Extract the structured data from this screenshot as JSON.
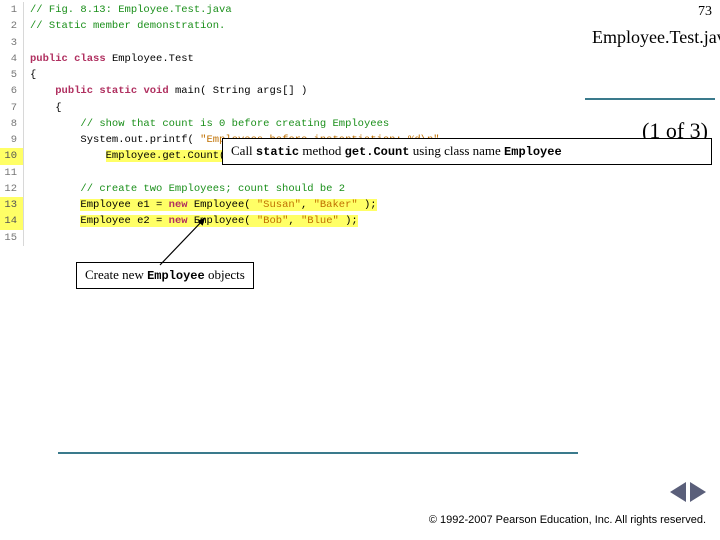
{
  "page_number": "73",
  "title": "Employee.Test.java",
  "part": "(1 of 3)",
  "code": {
    "lines": [
      {
        "n": "1",
        "hi": false
      },
      {
        "n": "2",
        "hi": false
      },
      {
        "n": "3",
        "hi": false
      },
      {
        "n": "4",
        "hi": false
      },
      {
        "n": "5",
        "hi": false
      },
      {
        "n": "6",
        "hi": false
      },
      {
        "n": "7",
        "hi": false
      },
      {
        "n": "8",
        "hi": false
      },
      {
        "n": "9",
        "hi": false
      },
      {
        "n": "10",
        "hi": true
      },
      {
        "n": "11",
        "hi": false
      },
      {
        "n": "12",
        "hi": false
      },
      {
        "n": "13",
        "hi": true
      },
      {
        "n": "14",
        "hi": true
      },
      {
        "n": "15",
        "hi": false
      }
    ],
    "l1_comment": "// Fig. 8.13: Employee.Test.java",
    "l2_comment": "// Static member demonstration.",
    "l4_kw1": "public",
    "l4_kw2": "class",
    "l4_name": " Employee.Test",
    "l5_brace": "{",
    "l6_indent": "    ",
    "l6_kw1": "public",
    "l6_kw2": " static",
    "l6_kw3": " void",
    "l6_main": " main( String args[] )",
    "l7_indent": "    ",
    "l7_brace": "{",
    "l8_indent": "        ",
    "l8_comment": "// show that count is 0 before creating Employees",
    "l9_indent": "        ",
    "l9_call": "System.out.printf( ",
    "l9_str": "\"Employees before instantiation: %d\\n\"",
    "l9_tail": ",",
    "l10_indent": "            ",
    "l10_hi": "Employee.get.Count()",
    "l10_tail": " );",
    "l12_indent": "        ",
    "l12_comment": "// create two Employees; count should be 2",
    "l13_indent": "        ",
    "l13_a": "Employee e1 = ",
    "l13_kw": "new",
    "l13_b": " Employee( ",
    "l13_s1": "\"Susan\"",
    "l13_c": ", ",
    "l13_s2": "\"Baker\"",
    "l13_d": " );",
    "l14_indent": "        ",
    "l14_a": "Employee e2 = ",
    "l14_kw": "new",
    "l14_b": " Employee( ",
    "l14_s1": "\"Bob\"",
    "l14_c": ", ",
    "l14_s2": "\"Blue\"",
    "l14_d": " );"
  },
  "callout1": {
    "t1": "Call ",
    "m1": "static",
    "t2": " method ",
    "m2": "get.Count",
    "t3": " using class name ",
    "m3": "Employee"
  },
  "callout2": {
    "t1": "Create new ",
    "m1": "Employee",
    "t2": " objects"
  },
  "copyright": "© 1992-2007 Pearson Education, Inc. All rights reserved."
}
